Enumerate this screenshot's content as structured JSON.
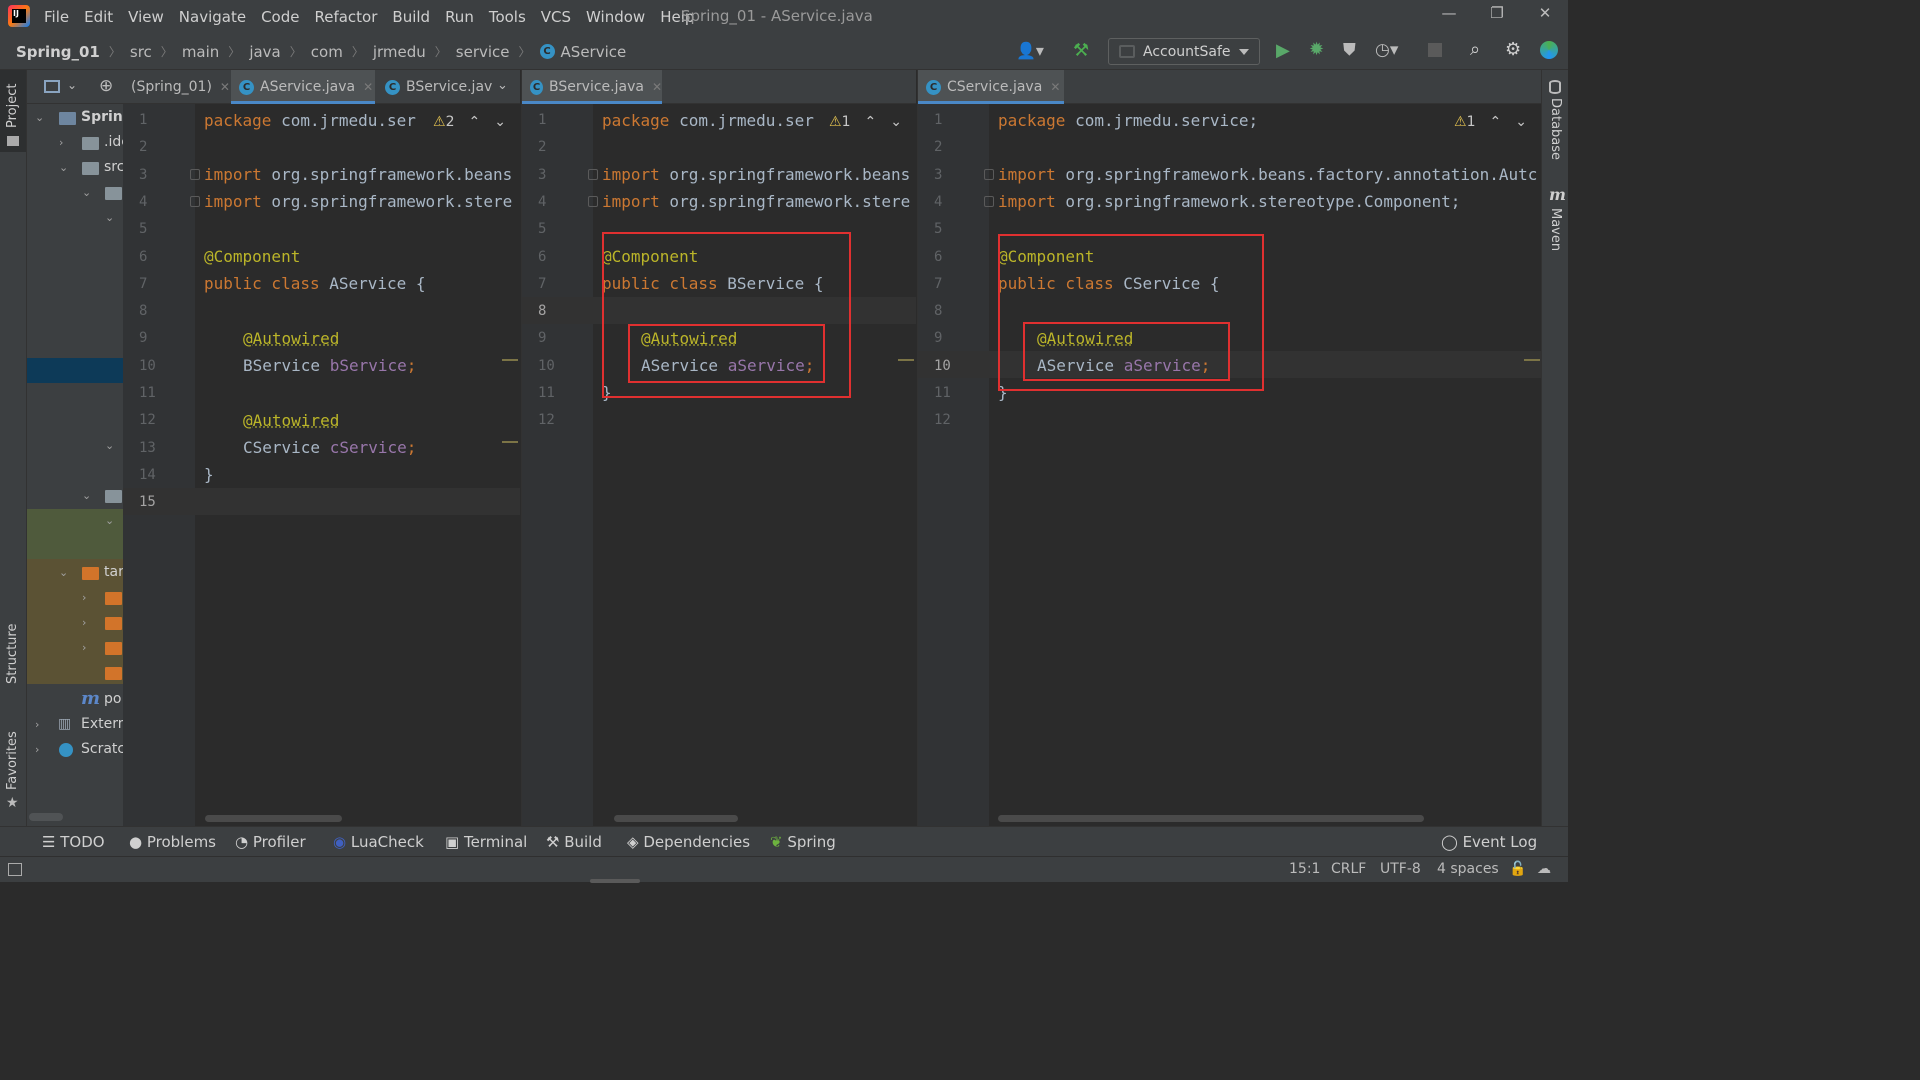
{
  "window": {
    "title": "Spring_01 - AService.java",
    "menus": [
      "File",
      "Edit",
      "View",
      "Navigate",
      "Code",
      "Refactor",
      "Build",
      "Run",
      "Tools",
      "VCS",
      "Window",
      "Help"
    ]
  },
  "breadcrumb": [
    "Spring_01",
    "src",
    "main",
    "java",
    "com",
    "jrmedu",
    "service",
    "AService"
  ],
  "run_config": "AccountSafe",
  "left_strip": {
    "project": "Project",
    "structure": "Structure",
    "favorites": "Favorites"
  },
  "right_strip": {
    "database": "Database",
    "maven": "Maven",
    "maven_icon": "m"
  },
  "project_tree": {
    "toolbar_label": "(Spring_01)",
    "items": [
      "Spring",
      ".ide",
      "src",
      "tar",
      "po",
      "Extern",
      "Scratcl"
    ]
  },
  "editors": [
    {
      "tabs": [
        {
          "label": "AService.java",
          "active": true
        },
        {
          "label": "BService.jav",
          "active": false
        }
      ],
      "warnings": "2",
      "line_numbers": [
        "1",
        "2",
        "3",
        "4",
        "5",
        "6",
        "7",
        "8",
        "9",
        "10",
        "11",
        "12",
        "13",
        "14",
        "15"
      ],
      "current_line": "15",
      "lines": {
        "l1": "package com.jrmedu.ser",
        "l3": "import org.springframework.beans",
        "l4": "import org.springframework.stere",
        "l6": "@Component",
        "l7": "public class AService {",
        "l9": "@Autowired",
        "l10": "BService bService;",
        "l12": "@Autowired",
        "l13": "CService cService;",
        "l14": "}"
      }
    },
    {
      "tabs": [
        {
          "label": "BService.java",
          "active": true
        }
      ],
      "warnings": "1",
      "line_numbers": [
        "1",
        "2",
        "3",
        "4",
        "5",
        "6",
        "7",
        "8",
        "9",
        "10",
        "11",
        "12"
      ],
      "current_line": "8",
      "lines": {
        "l1": "package com.jrmedu.ser",
        "l3": "import org.springframework.beans",
        "l4": "import org.springframework.stere",
        "l6": "@Component",
        "l7": "public class BService {",
        "l9": "@Autowired",
        "l10": "AService aService;",
        "l11": "}"
      }
    },
    {
      "tabs": [
        {
          "label": "CService.java",
          "active": true
        }
      ],
      "warnings": "1",
      "line_numbers": [
        "1",
        "2",
        "3",
        "4",
        "5",
        "6",
        "7",
        "8",
        "9",
        "10",
        "11",
        "12"
      ],
      "current_line": "10",
      "lines": {
        "l1": "package com.jrmedu.service;",
        "l3": "import org.springframework.beans.factory.annotation.Autc",
        "l4": "import org.springframework.stereotype.Component;",
        "l6": "@Component",
        "l7": "public class CService {",
        "l9": "@Autowired",
        "l10": "AService aService;",
        "l11": "}"
      }
    }
  ],
  "bottom_tools": [
    "TODO",
    "Problems",
    "Profiler",
    "LuaCheck",
    "Terminal",
    "Build",
    "Dependencies",
    "Spring",
    "Event Log"
  ],
  "status": {
    "position": "15:1",
    "line_sep": "CRLF",
    "encoding": "UTF-8",
    "indent": "4 spaces"
  },
  "colors": {
    "keyword": "#cc7832",
    "annotation": "#bbb529",
    "field": "#9876aa",
    "highlight_box": "#e03030",
    "accent": "#4a88c7"
  }
}
